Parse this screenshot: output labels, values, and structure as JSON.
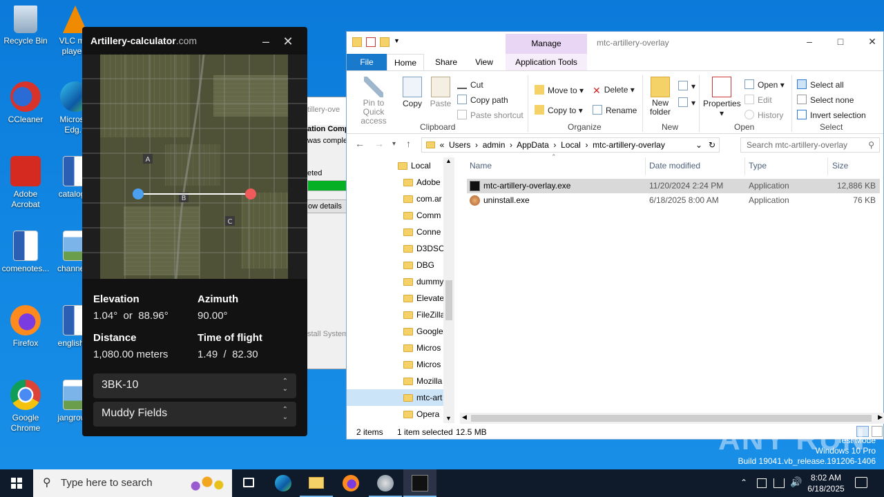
{
  "desktop": {
    "icons": [
      {
        "label": "Recycle Bin"
      },
      {
        "label": "VLC m... playe..."
      },
      {
        "label": "CCleaner"
      },
      {
        "label": "Micros... Edg..."
      },
      {
        "label": "Adobe Acrobat"
      },
      {
        "label": "catalog..."
      },
      {
        "label": "comenotes..."
      },
      {
        "label": "channel..."
      },
      {
        "label": "Firefox"
      },
      {
        "label": "englishi..."
      },
      {
        "label": "Google Chrome"
      },
      {
        "label": "jangrow..."
      }
    ]
  },
  "artillery": {
    "title": "Artillery-calculator",
    "title_domain": ".com",
    "map_labels": [
      "A",
      "B",
      "C"
    ],
    "elevation_label": "Elevation",
    "elevation_value": "1.04°",
    "elevation_or": "or",
    "elevation_alt": "88.96°",
    "azimuth_label": "Azimuth",
    "azimuth_value": "90.00°",
    "distance_label": "Distance",
    "distance_value": "1,080.00 meters",
    "tof_label": "Time of flight",
    "tof_value": "1.49",
    "tof_sep": "/",
    "tof_alt": "82.30",
    "weapon_select": "3BK-10",
    "map_select": "Muddy Fields",
    "colors": {
      "start_marker": "#4a9ff0",
      "end_marker": "#f05a5a"
    }
  },
  "installer_fragment": {
    "lines": [
      "tillery-ove",
      "ation Comp",
      "was complet",
      "eted",
      "ow details",
      "stall System"
    ]
  },
  "explorer": {
    "manage_label": "Manage",
    "app_tools_label": "Application Tools",
    "window_title": "mtc-artillery-overlay",
    "tabs": {
      "file": "File",
      "home": "Home",
      "share": "Share",
      "view": "View"
    },
    "ribbon": {
      "pin": "Pin to Quick access",
      "copy": "Copy",
      "paste": "Paste",
      "cut": "Cut",
      "copy_path": "Copy path",
      "paste_shortcut": "Paste shortcut",
      "clipboard": "Clipboard",
      "move_to": "Move to",
      "copy_to": "Copy to",
      "delete": "Delete",
      "rename": "Rename",
      "organize": "Organize",
      "new_folder": "New folder",
      "new": "New",
      "properties": "Properties",
      "open": "Open",
      "edit": "Edit",
      "history": "History",
      "open_group": "Open",
      "select_all": "Select all",
      "select_none": "Select none",
      "invert": "Invert selection",
      "select_group": "Select"
    },
    "breadcrumb": [
      "Users",
      "admin",
      "AppData",
      "Local",
      "mtc-artillery-overlay"
    ],
    "search_placeholder": "Search mtc-artillery-overlay",
    "tree": [
      "Local",
      "Adobe",
      "com.ar",
      "Comm",
      "Conne",
      "D3DSC",
      "DBG",
      "dummy",
      "Elevate",
      "FileZilla",
      "Google",
      "Micros",
      "Micros",
      "Mozilla",
      "mtc-art",
      "Opera"
    ],
    "columns": {
      "name": "Name",
      "date": "Date modified",
      "type": "Type",
      "size": "Size"
    },
    "files": [
      {
        "name": "mtc-artillery-overlay.exe",
        "date": "11/20/2024 2:24 PM",
        "type": "Application",
        "size": "12,886 KB"
      },
      {
        "name": "uninstall.exe",
        "date": "6/18/2025 8:00 AM",
        "type": "Application",
        "size": "76 KB"
      }
    ],
    "status": {
      "items": "2 items",
      "selected": "1 item selected",
      "size": "12.5 MB"
    }
  },
  "watermark": {
    "line1": "Test Mode",
    "line2": "Windows 10 Pro",
    "line3": "Build 19041.vb_release.191206-1406",
    "brand": "ANY RUN"
  },
  "taskbar": {
    "search_placeholder": "Type here to search",
    "time": "8:02 AM",
    "date": "6/18/2025"
  }
}
